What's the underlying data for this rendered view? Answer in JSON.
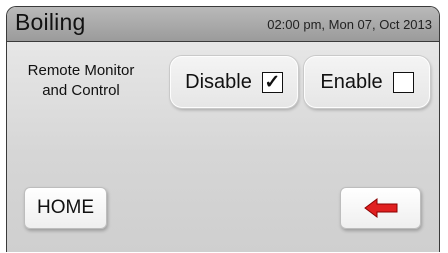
{
  "header": {
    "title": "Boiling",
    "datetime": "02:00 pm, Mon 07, Oct 2013"
  },
  "setting": {
    "label_line1": "Remote Monitor",
    "label_line2": "and Control",
    "options": [
      {
        "label": "Disable",
        "checked": true,
        "mark": "✓"
      },
      {
        "label": "Enable",
        "checked": false,
        "mark": ""
      }
    ]
  },
  "footer": {
    "home_label": "HOME",
    "back_icon": "left-arrow-icon",
    "back_icon_color": "#e02020"
  }
}
